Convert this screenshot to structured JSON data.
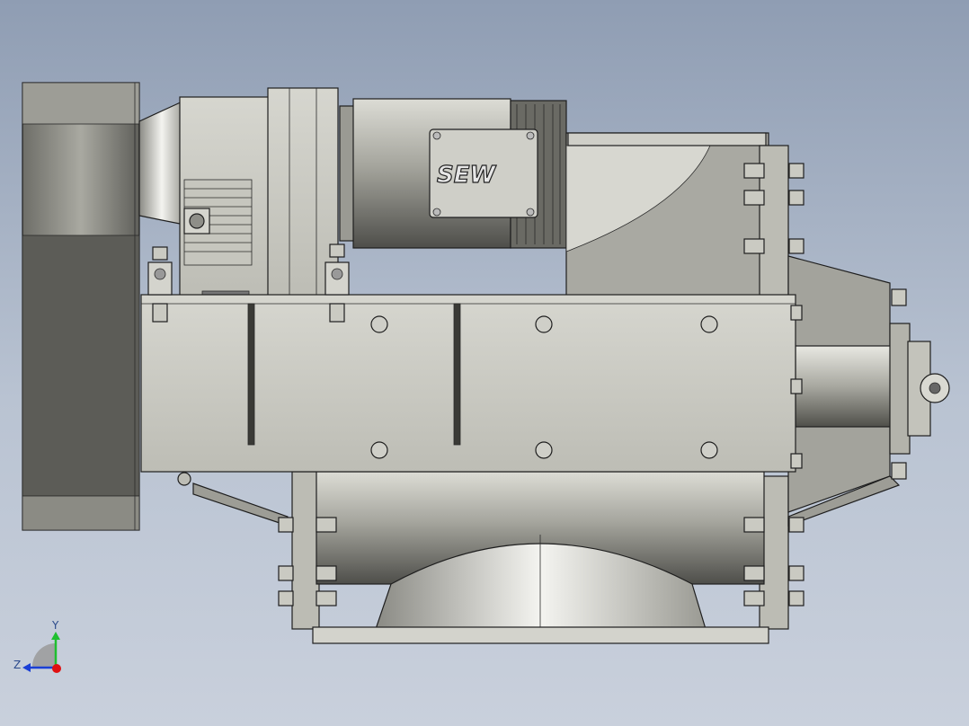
{
  "model": {
    "brand_label": "SEW"
  },
  "triad": {
    "y_label": "Y",
    "z_label": "Z",
    "colors": {
      "y_axis": "#1fbf2f",
      "z_axis": "#1a3fd6",
      "x_axis": "#e01010"
    }
  },
  "colors": {
    "background_top": "#8f9db3",
    "background_bottom": "#c9d0dc",
    "metal_light": "#e2e2dc",
    "metal_mid": "#b9b9b1",
    "metal_dark": "#5a5a56"
  }
}
